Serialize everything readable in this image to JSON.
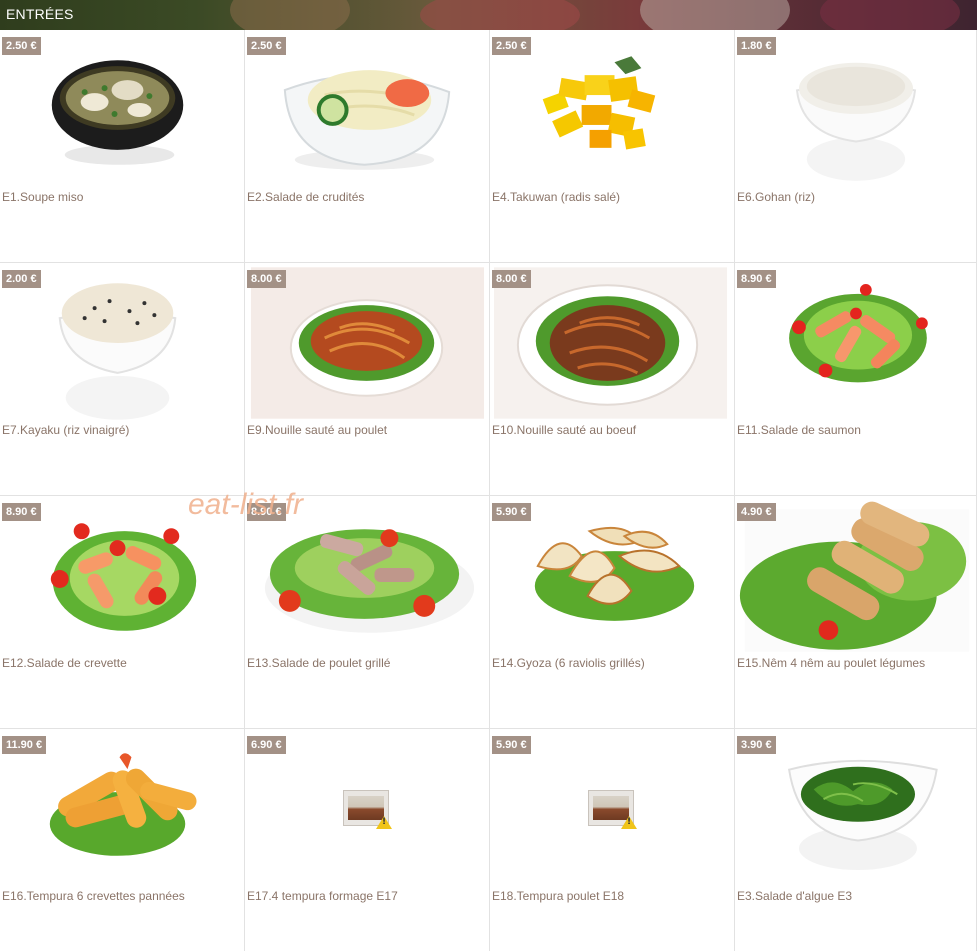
{
  "header": {
    "title": "ENTRÉES"
  },
  "watermark": "eat-list.fr",
  "items": [
    {
      "code": "E1",
      "price": "2.50 €",
      "name": "E1.Soupe miso",
      "image": "miso-soup-bowl"
    },
    {
      "code": "E2",
      "price": "2.50 €",
      "name": "E2.Salade de crudités",
      "image": "cabbage-salad-bowl"
    },
    {
      "code": "E4",
      "price": "2.50 €",
      "name": "E4.Takuwan (radis salé)",
      "image": "pickled-radish"
    },
    {
      "code": "E6",
      "price": "1.80 €",
      "name": "E6.Gohan (riz)",
      "image": "rice-bowl"
    },
    {
      "code": "E7",
      "price": "2.00 €",
      "name": "E7.Kayaku (riz vinaigré)",
      "image": "sesame-rice-bowl"
    },
    {
      "code": "E9",
      "price": "8.00 €",
      "name": "E9.Nouille sauté au poulet",
      "image": "fried-noodles-plate"
    },
    {
      "code": "E10",
      "price": "8.00 €",
      "name": "E10.Nouille sauté au boeuf",
      "image": "beef-noodles-plate"
    },
    {
      "code": "E11",
      "price": "8.90 €",
      "name": "E11.Salade de saumon",
      "image": "salmon-salad"
    },
    {
      "code": "E12",
      "price": "8.90 €",
      "name": "E12.Salade de crevette",
      "image": "shrimp-salad"
    },
    {
      "code": "E13",
      "price": "8.90 €",
      "name": "E13.Salade de poulet grillé",
      "image": "chicken-salad"
    },
    {
      "code": "E14",
      "price": "5.90 €",
      "name": "E14.Gyoza (6 raviolis grillés)",
      "image": "gyoza"
    },
    {
      "code": "E15",
      "price": "4.90 €",
      "name": "E15.Nêm 4 nêm au poulet légumes",
      "image": "spring-rolls"
    },
    {
      "code": "E16",
      "price": "11.90 €",
      "name": "E16.Tempura 6 crevettes pannées",
      "image": "tempura-shrimp"
    },
    {
      "code": "E17",
      "price": "6.90 €",
      "name": "E17.4 tempura formage E17",
      "image": "broken-image"
    },
    {
      "code": "E18",
      "price": "5.90 €",
      "name": "E18.Tempura poulet E18",
      "image": "broken-image"
    },
    {
      "code": "E3",
      "price": "3.90 €",
      "name": "E3.Salade d'algue E3",
      "image": "seaweed-salad-bowl"
    }
  ],
  "colors": {
    "price_badge": "#a39186",
    "item_text": "#8a7468",
    "border": "#e2e2e2",
    "watermark": "#f0b08c"
  }
}
